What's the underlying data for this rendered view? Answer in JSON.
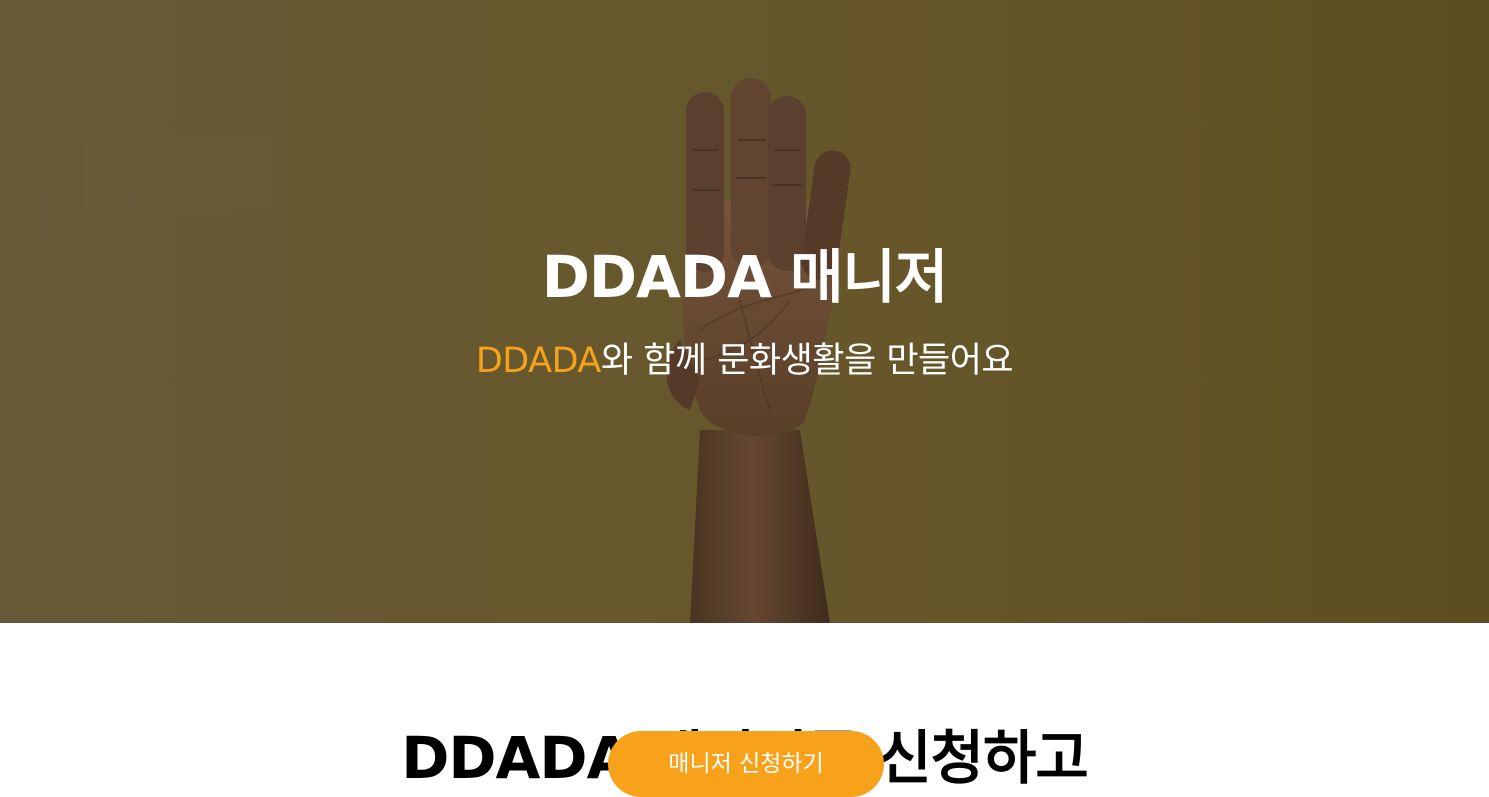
{
  "hero": {
    "title": "DDADA 매니저",
    "subtitle_brand": "DDADA",
    "subtitle_rest": "와 함께 문화생활을 만들어요",
    "background_color": "#6a5a2c",
    "brand_color": "#f7a21b"
  },
  "section": {
    "heading": "DDADA 매니저를 신청하고"
  },
  "cta": {
    "label": "매니저 신청하기",
    "color": "#f8a11a"
  }
}
